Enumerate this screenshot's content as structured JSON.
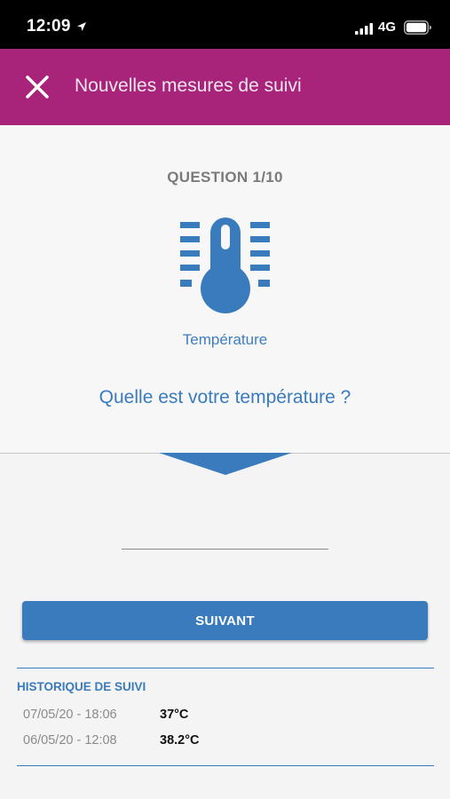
{
  "status_bar": {
    "time": "12:09",
    "network": "4G"
  },
  "header": {
    "title": "Nouvelles mesures de suivi"
  },
  "question": {
    "counter": "QUESTION 1/10",
    "category": "Température",
    "text": "Quelle est votre température ?"
  },
  "answer": {
    "value": "",
    "placeholder": ""
  },
  "actions": {
    "next_label": "SUIVANT"
  },
  "history": {
    "title": "HISTORIQUE DE SUIVI",
    "entries": [
      {
        "date": "07/05/20 - 18:06",
        "value": "37°C"
      },
      {
        "date": "06/05/20 - 12:08",
        "value": "38.2°C"
      }
    ]
  },
  "colors": {
    "header_bg": "#a8247b",
    "accent": "#3a7bbd",
    "background": "#f4f4f4"
  },
  "icons": {
    "close": "close-icon",
    "category": "thermometer-icon"
  }
}
